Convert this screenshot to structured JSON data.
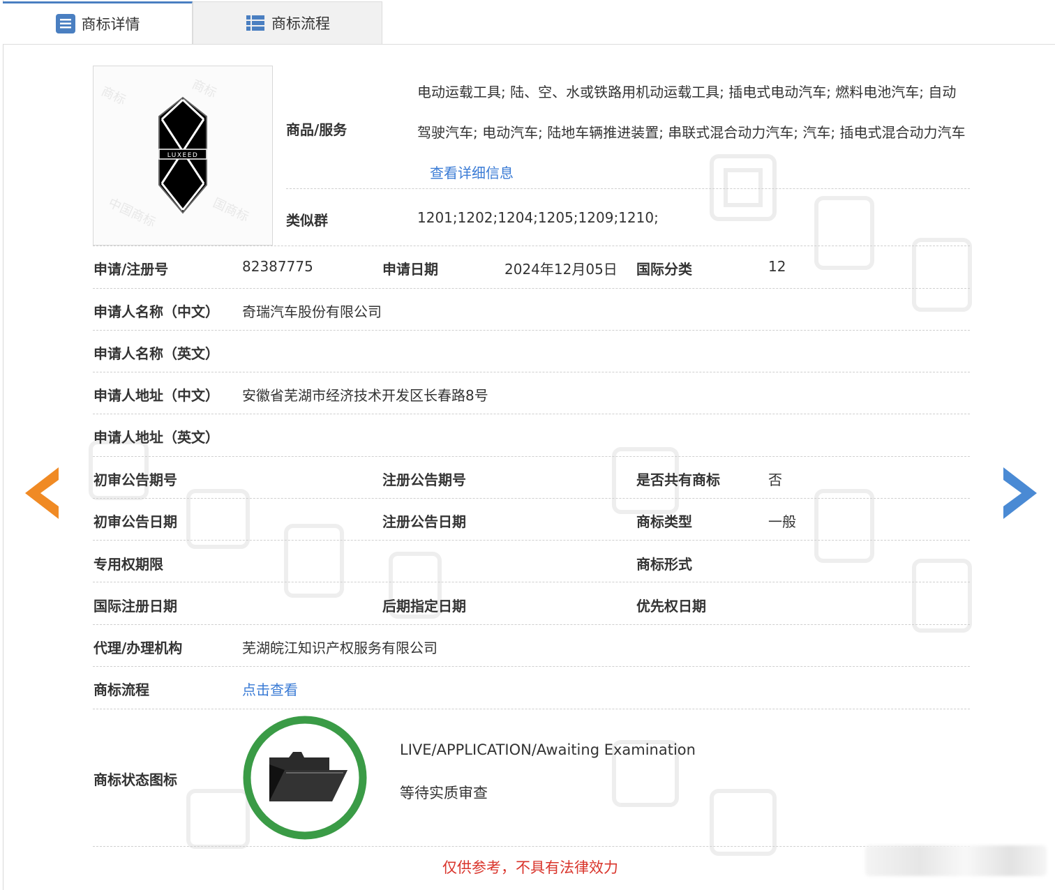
{
  "tabs": [
    {
      "label": "商标详情",
      "icon": "list-doc-icon",
      "active": true
    },
    {
      "label": "商标流程",
      "icon": "list-bullets-icon",
      "active": false
    }
  ],
  "logo": {
    "text": "LUXEED"
  },
  "goods": {
    "label": "商品/服务",
    "value": "电动运载工具; 陆、空、水或铁路用机动运载工具; 插电式电动汽车; 燃料电池汽车; 自动驾驶汽车; 电动汽车; 陆地车辆推进装置; 串联式混合动力汽车; 汽车; 插电式混合动力汽车",
    "link": "查看详细信息"
  },
  "similar_group": {
    "label": "类似群",
    "value": "1201;1202;1204;1205;1209;1210;"
  },
  "rows": {
    "reg_no": {
      "label": "申请/注册号",
      "value": "82387775"
    },
    "apply_date": {
      "label": "申请日期",
      "value": "2024年12月05日"
    },
    "intl_class": {
      "label": "国际分类",
      "value": "12"
    },
    "applicant_cn": {
      "label": "申请人名称（中文）",
      "value": "奇瑞汽车股份有限公司"
    },
    "applicant_en": {
      "label": "申请人名称（英文）",
      "value": ""
    },
    "address_cn": {
      "label": "申请人地址（中文）",
      "value": "安徽省芜湖市经济技术开发区长春路8号"
    },
    "address_en": {
      "label": "申请人地址（英文）",
      "value": ""
    },
    "prelim_no": {
      "label": "初审公告期号",
      "value": ""
    },
    "reg_notice_no": {
      "label": "注册公告期号",
      "value": ""
    },
    "shared": {
      "label": "是否共有商标",
      "value": "否"
    },
    "prelim_date": {
      "label": "初审公告日期",
      "value": ""
    },
    "reg_notice_date": {
      "label": "注册公告日期",
      "value": ""
    },
    "tm_type": {
      "label": "商标类型",
      "value": "一般"
    },
    "exclusive_term": {
      "label": "专用权期限",
      "value": ""
    },
    "tm_form": {
      "label": "商标形式",
      "value": ""
    },
    "intl_reg_date": {
      "label": "国际注册日期",
      "value": ""
    },
    "later_date": {
      "label": "后期指定日期",
      "value": ""
    },
    "priority_date": {
      "label": "优先权日期",
      "value": ""
    },
    "agency": {
      "label": "代理/办理机构",
      "value": "芜湖皖江知识产权服务有限公司"
    },
    "flow": {
      "label": "商标流程",
      "link": "点击查看"
    }
  },
  "status": {
    "label": "商标状态图标",
    "icon": "folder-open-icon",
    "line_en": "LIVE/APPLICATION/Awaiting Examination",
    "line_cn": "等待实质审查",
    "ring_color": "#3a9b46"
  },
  "disclaimer": "仅供参考，不具有法律效力",
  "colors": {
    "link": "#3a7bd5",
    "prev_arrow": "#f08a24",
    "next_arrow": "#4a8ad4",
    "disclaimer": "#d9342b"
  }
}
